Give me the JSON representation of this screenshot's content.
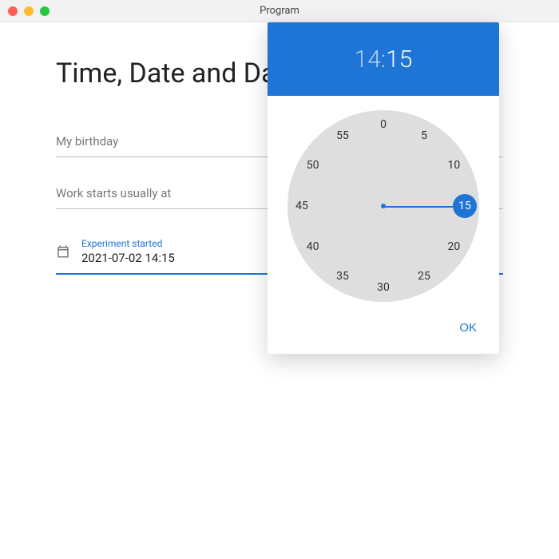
{
  "window": {
    "title": "Program"
  },
  "page": {
    "heading": "Time, Date and DateTime"
  },
  "fields": {
    "birthday": {
      "label": "My birthday"
    },
    "work": {
      "label": "Work starts usually at"
    },
    "experiment": {
      "label": "Experiment started",
      "value": "2021-07-02 14:15"
    }
  },
  "picker": {
    "hour": "14",
    "sep": ":",
    "minute": "15",
    "ok": "OK",
    "marks": [
      "0",
      "5",
      "10",
      "15",
      "20",
      "25",
      "30",
      "35",
      "40",
      "45",
      "50",
      "55"
    ],
    "selected_index": 3
  }
}
